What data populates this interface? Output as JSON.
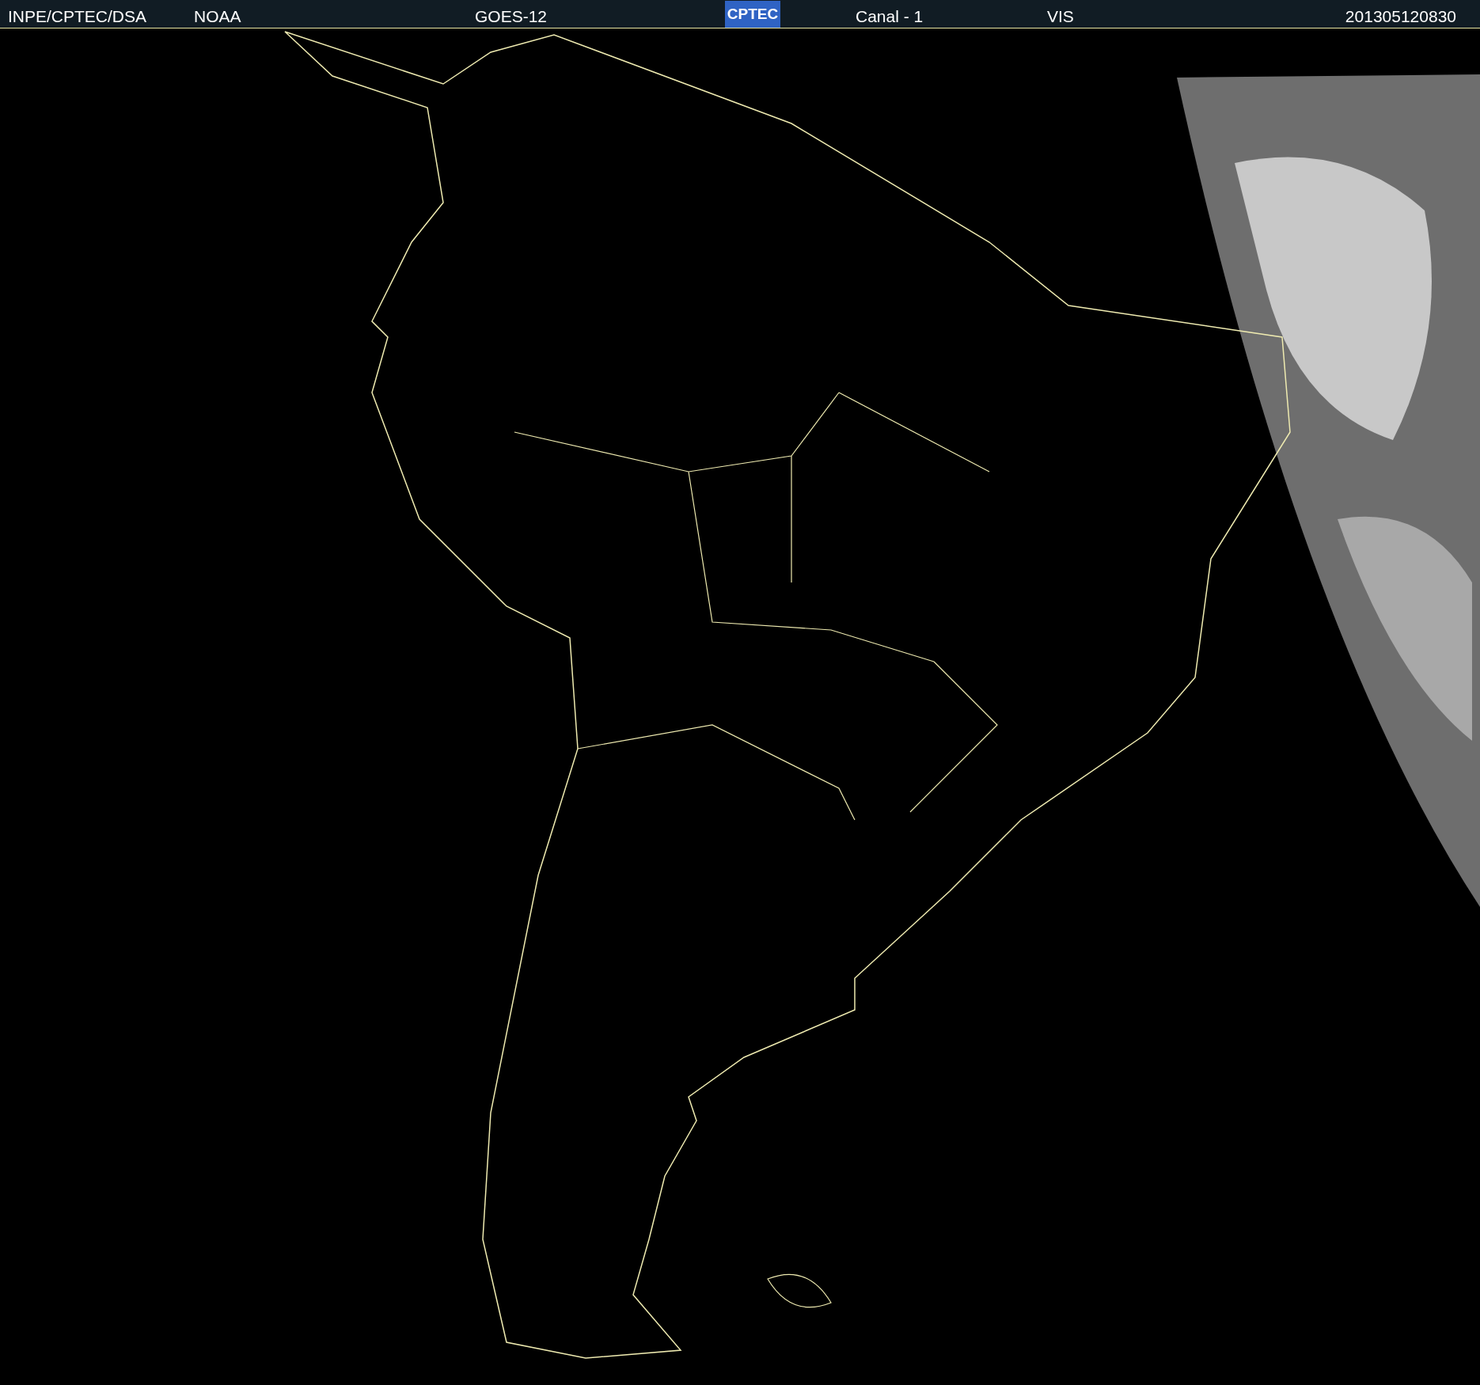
{
  "header": {
    "source": "INPE/CPTEC/DSA",
    "agency": "NOAA",
    "satellite": "GOES-12",
    "logo": "CPTEC",
    "channel": "Canal - 1",
    "band": "VIS",
    "timestamp": "201305120830"
  }
}
